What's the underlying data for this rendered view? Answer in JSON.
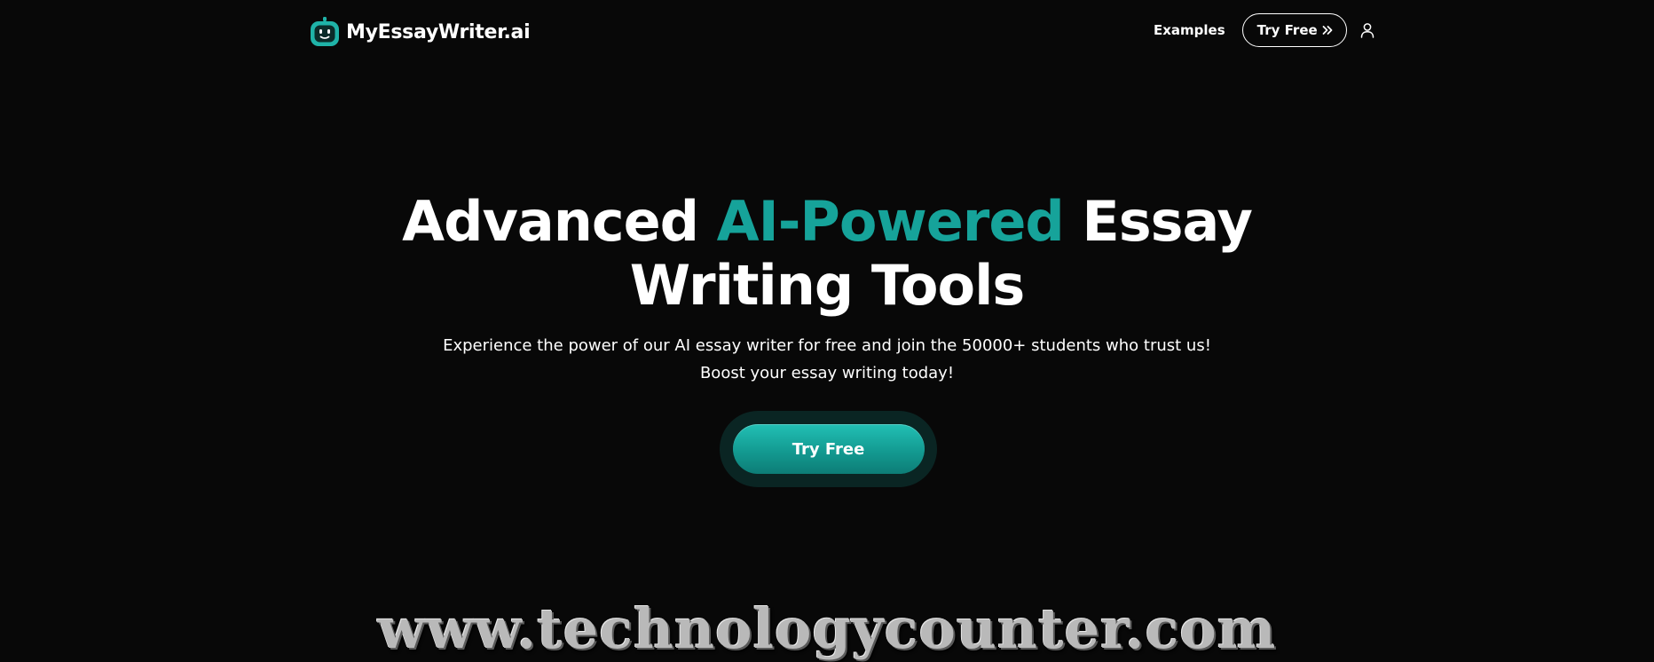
{
  "header": {
    "logo_text": "MyEssayWriter.ai",
    "nav": {
      "examples_label": "Examples",
      "try_free_label": "Try Free"
    }
  },
  "hero": {
    "title_part1": "Advanced ",
    "title_accent": "AI-Powered",
    "title_part2": " Essay",
    "title_line2": "Writing Tools",
    "subtitle_line1": "Experience the power of our AI essay writer for free and join the 50000+ students who trust us!",
    "subtitle_line2": "Boost your essay writing today!",
    "cta_label": "Try Free"
  },
  "watermark": "www.technologycounter.com",
  "icons": {
    "logo": "robot-face-icon",
    "nav_button": "double-chevron-right-icon",
    "account": "user-icon"
  },
  "colors": {
    "background": "#080808",
    "accent": "#16a39a",
    "cta_gradient_top": "#22c0b5",
    "cta_gradient_bottom": "#0d7d76",
    "cta_halo": "#0a2523",
    "text": "#ffffff"
  }
}
